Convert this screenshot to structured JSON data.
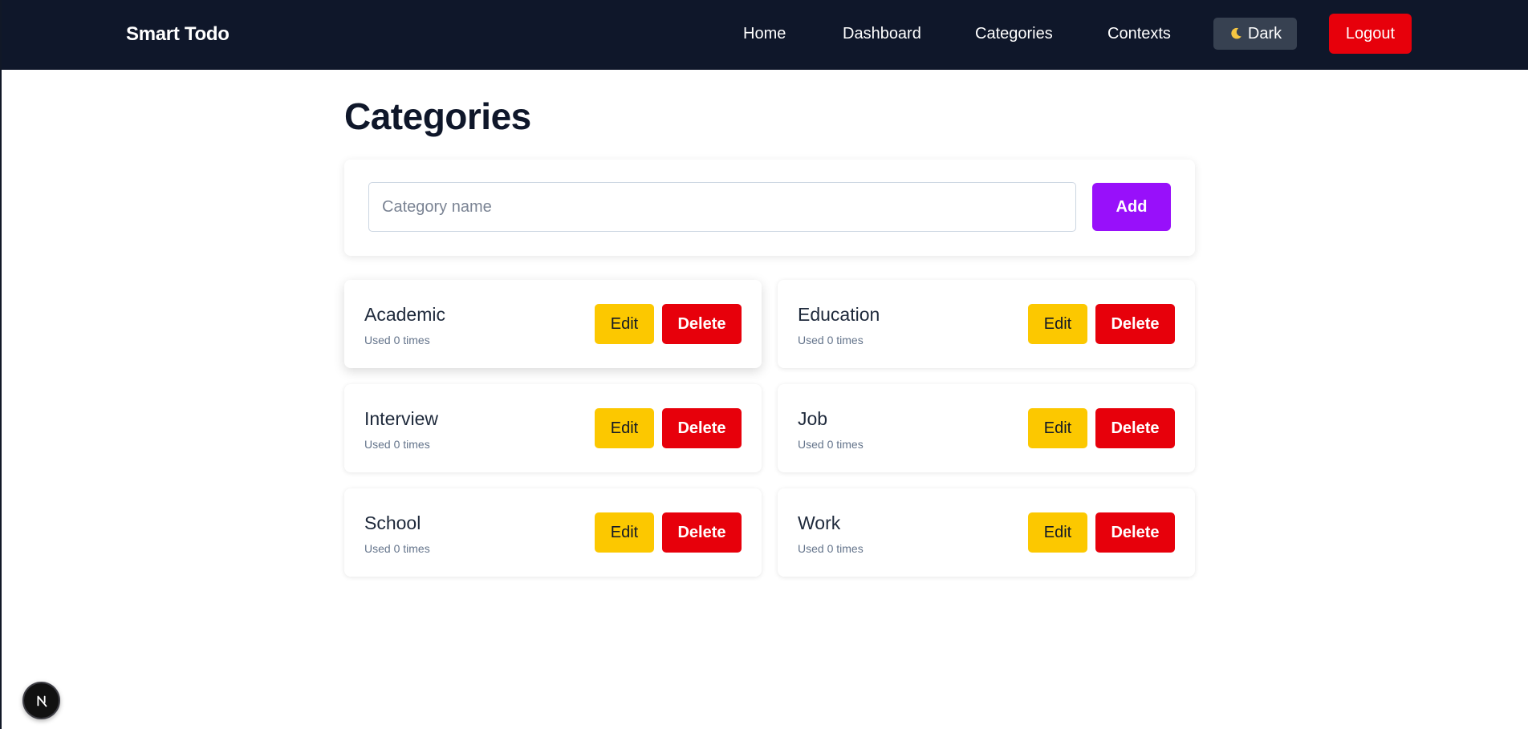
{
  "app": {
    "brand": "Smart Todo"
  },
  "nav": {
    "links": [
      "Home",
      "Dashboard",
      "Categories",
      "Contexts"
    ],
    "theme_toggle": {
      "label": "Dark",
      "icon": "moon-icon"
    },
    "logout_label": "Logout"
  },
  "page": {
    "title": "Categories"
  },
  "add_form": {
    "input_value": "",
    "input_placeholder": "Category name",
    "add_label": "Add"
  },
  "categories": [
    {
      "name": "Academic",
      "usage": "Used 0 times",
      "edit_label": "Edit",
      "delete_label": "Delete"
    },
    {
      "name": "Education",
      "usage": "Used 0 times",
      "edit_label": "Edit",
      "delete_label": "Delete"
    },
    {
      "name": "Interview",
      "usage": "Used 0 times",
      "edit_label": "Edit",
      "delete_label": "Delete"
    },
    {
      "name": "Job",
      "usage": "Used 0 times",
      "edit_label": "Edit",
      "delete_label": "Delete"
    },
    {
      "name": "School",
      "usage": "Used 0 times",
      "edit_label": "Edit",
      "delete_label": "Delete"
    },
    {
      "name": "Work",
      "usage": "Used 0 times",
      "edit_label": "Edit",
      "delete_label": "Delete"
    }
  ],
  "colors": {
    "navbar_bg": "#0f172a",
    "primary_purple": "#9810fa",
    "danger_red": "#e7000b",
    "edit_yellow": "#fcc800",
    "dark_button": "#374151"
  },
  "floating_badge": {
    "icon": "nextjs-logo-icon"
  }
}
